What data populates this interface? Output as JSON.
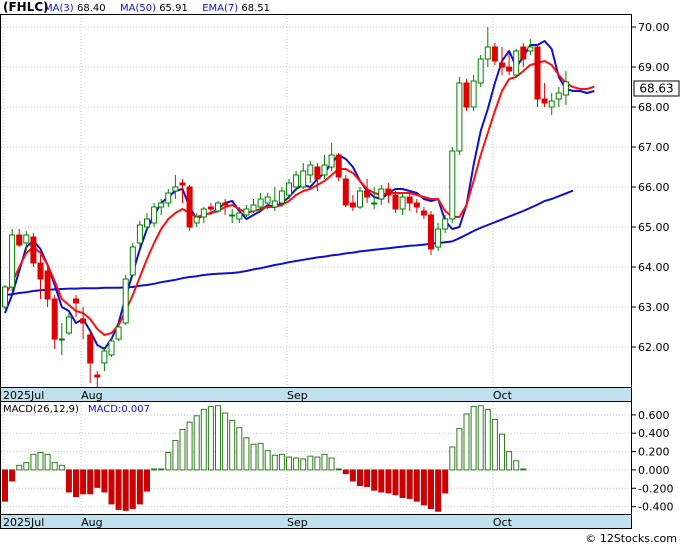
{
  "header": {
    "symbol": "(FHLC)",
    "ma_legend": [
      {
        "label": "MA(3)",
        "value": "68.40"
      },
      {
        "label": "MA(50)",
        "value": "65.91"
      },
      {
        "label": "EMA(7)",
        "value": "68.51"
      }
    ],
    "last_price": "68.63"
  },
  "watermark": "© 12Stocks.com",
  "colors": {
    "up": "#008000",
    "down": "#e00000",
    "ma3": "#1010cc",
    "ma50": "#1010cc",
    "ema7": "#ff1010",
    "macd_pos": "#2e7d1e",
    "macd_neg": "#cc0000",
    "axis_band": "#bfe0ec",
    "frame": "#000000",
    "grid": "#c8c8c8"
  },
  "chart_data": [
    {
      "type": "candlestick",
      "title": "(FHLC)",
      "ylim": [
        61.0,
        70.3
      ],
      "y_ticks": [
        "70.00",
        "69.00",
        "68.00",
        "67.00",
        "66.00",
        "65.00",
        "64.00",
        "63.00",
        "62.00"
      ],
      "x_labels": [
        "2025Jul",
        "Aug",
        "Sep",
        "Oct"
      ],
      "label_at_index": [
        0,
        11,
        40,
        69
      ],
      "grid": true,
      "series": [
        {
          "name": "MA(3)",
          "values": [
            62.85,
            63.3,
            63.9,
            64.5,
            64.65,
            64.45,
            64.05,
            63.55,
            63.0,
            62.9,
            62.6,
            62.7,
            62.4,
            62.05,
            61.95,
            62.2,
            62.6,
            63.25,
            63.85,
            64.45,
            64.95,
            65.3,
            65.6,
            65.75,
            65.9,
            65.95,
            65.5,
            65.2,
            65.3,
            65.35,
            65.45,
            65.6,
            65.65,
            65.4,
            65.2,
            65.3,
            65.4,
            65.55,
            65.5,
            65.6,
            65.75,
            65.95,
            66.05,
            66.0,
            66.2,
            66.35,
            66.6,
            66.8,
            66.7,
            66.5,
            66.15,
            65.9,
            65.75,
            65.7,
            65.85,
            65.95,
            65.95,
            65.9,
            65.85,
            65.7,
            65.65,
            65.7,
            65.15,
            64.95,
            65.0,
            65.55,
            66.55,
            67.4,
            67.95,
            68.6,
            69.15,
            69.4,
            69.0,
            69.25,
            69.55,
            69.55,
            69.65,
            69.45,
            68.75,
            68.45,
            68.4,
            68.4,
            68.35,
            68.4
          ],
          "from_index": 0
        },
        {
          "name": "MA(50)",
          "values": [
            63.3,
            63.32,
            63.35,
            63.37,
            63.4,
            63.42,
            63.43,
            63.44,
            63.45,
            63.46,
            63.46,
            63.47,
            63.47,
            63.47,
            63.48,
            63.48,
            63.48,
            63.49,
            63.5,
            63.53,
            63.55,
            63.58,
            63.62,
            63.65,
            63.68,
            63.72,
            63.75,
            63.77,
            63.8,
            63.82,
            63.83,
            63.84,
            63.85,
            63.87,
            63.9,
            63.94,
            63.97,
            64.01,
            64.05,
            64.08,
            64.12,
            64.15,
            64.18,
            64.21,
            64.24,
            64.26,
            64.29,
            64.31,
            64.34,
            64.36,
            64.39,
            64.41,
            64.43,
            64.45,
            64.47,
            64.49,
            64.51,
            64.53,
            64.54,
            64.56,
            64.58,
            64.6,
            64.62,
            64.64,
            64.72,
            64.81,
            64.9,
            64.98,
            65.05,
            65.12,
            65.19,
            65.26,
            65.33,
            65.4,
            65.48,
            65.56,
            65.65,
            65.7,
            65.77,
            65.84,
            65.91
          ],
          "from_index": 0
        },
        {
          "name": "EMA(7)",
          "values": [
            63.3,
            63.6,
            64.0,
            64.35,
            64.5,
            64.35,
            64.05,
            63.65,
            63.2,
            63.05,
            62.9,
            62.85,
            62.7,
            62.45,
            62.3,
            62.35,
            62.55,
            62.9,
            63.3,
            63.75,
            64.2,
            64.6,
            64.95,
            65.2,
            65.35,
            65.45,
            65.35,
            65.25,
            65.3,
            65.35,
            65.4,
            65.5,
            65.55,
            65.45,
            65.35,
            65.4,
            65.45,
            65.5,
            65.5,
            65.55,
            65.65,
            65.8,
            65.9,
            65.95,
            66.05,
            66.15,
            66.3,
            66.45,
            66.45,
            66.35,
            66.15,
            65.95,
            65.85,
            65.8,
            65.85,
            65.85,
            65.85,
            65.85,
            65.8,
            65.75,
            65.7,
            65.7,
            65.4,
            65.25,
            65.25,
            65.55,
            66.15,
            66.8,
            67.35,
            67.9,
            68.4,
            68.7,
            68.75,
            68.9,
            69.05,
            69.1,
            69.15,
            69.05,
            68.8,
            68.6,
            68.5,
            68.45,
            68.45,
            68.51
          ],
          "from_index": 0
        }
      ],
      "candles": [
        [
          63.0,
          63.5,
          62.95,
          63.55
        ],
        [
          63.5,
          64.8,
          63.4,
          64.95
        ],
        [
          64.8,
          64.55,
          64.5,
          64.95
        ],
        [
          64.6,
          64.8,
          64.4,
          64.9
        ],
        [
          64.75,
          64.1,
          64.0,
          64.85
        ],
        [
          64.1,
          63.7,
          63.2,
          64.3
        ],
        [
          63.9,
          63.2,
          63.0,
          64.0
        ],
        [
          63.2,
          62.2,
          61.95,
          63.3
        ],
        [
          62.2,
          62.2,
          61.8,
          62.6
        ],
        [
          62.35,
          62.75,
          62.3,
          62.85
        ],
        [
          63.2,
          63.1,
          62.75,
          63.3
        ],
        [
          62.7,
          62.6,
          62.2,
          63.0
        ],
        [
          62.3,
          61.6,
          61.1,
          62.4
        ],
        [
          61.3,
          61.25,
          61.0,
          61.4
        ],
        [
          61.6,
          61.9,
          61.4,
          62.0
        ],
        [
          61.8,
          62.15,
          61.75,
          62.25
        ],
        [
          62.2,
          62.5,
          62.15,
          62.55
        ],
        [
          62.6,
          63.7,
          62.55,
          63.8
        ],
        [
          63.8,
          64.5,
          63.75,
          64.6
        ],
        [
          64.6,
          65.05,
          64.5,
          65.15
        ],
        [
          65.0,
          65.2,
          64.9,
          65.35
        ],
        [
          65.1,
          65.5,
          65.0,
          65.6
        ],
        [
          65.5,
          65.6,
          65.3,
          65.7
        ],
        [
          65.6,
          65.85,
          65.5,
          65.95
        ],
        [
          65.9,
          66.0,
          65.7,
          66.3
        ],
        [
          66.1,
          66.05,
          65.6,
          66.2
        ],
        [
          66.0,
          65.0,
          64.9,
          66.05
        ],
        [
          65.1,
          65.25,
          65.0,
          65.35
        ],
        [
          65.25,
          65.45,
          65.1,
          65.5
        ],
        [
          65.5,
          65.45,
          65.3,
          65.6
        ],
        [
          65.4,
          65.6,
          65.35,
          65.65
        ],
        [
          65.6,
          65.55,
          65.3,
          65.7
        ],
        [
          65.3,
          65.3,
          65.1,
          65.45
        ],
        [
          65.2,
          65.35,
          65.1,
          65.5
        ],
        [
          65.3,
          65.45,
          65.25,
          65.55
        ],
        [
          65.4,
          65.55,
          65.35,
          65.7
        ],
        [
          65.5,
          65.7,
          65.4,
          65.85
        ],
        [
          65.6,
          65.75,
          65.45,
          65.85
        ],
        [
          65.5,
          65.65,
          65.4,
          66.0
        ],
        [
          65.6,
          65.9,
          65.5,
          66.0
        ],
        [
          65.8,
          66.1,
          65.7,
          66.2
        ],
        [
          66.0,
          66.3,
          65.9,
          66.4
        ],
        [
          66.0,
          66.4,
          65.95,
          66.6
        ],
        [
          66.3,
          66.55,
          66.1,
          66.65
        ],
        [
          66.5,
          66.2,
          65.9,
          66.6
        ],
        [
          66.3,
          66.55,
          66.2,
          66.8
        ],
        [
          66.5,
          66.8,
          66.4,
          67.1
        ],
        [
          66.8,
          66.25,
          66.15,
          66.85
        ],
        [
          66.2,
          65.55,
          65.5,
          66.3
        ],
        [
          65.6,
          65.5,
          65.4,
          65.8
        ],
        [
          65.5,
          65.9,
          65.45,
          66.0
        ],
        [
          65.9,
          65.75,
          65.6,
          66.2
        ],
        [
          65.6,
          65.6,
          65.45,
          66.0
        ],
        [
          65.7,
          65.95,
          65.55,
          66.05
        ],
        [
          65.95,
          65.8,
          65.6,
          66.1
        ],
        [
          65.8,
          65.45,
          65.35,
          65.9
        ],
        [
          65.45,
          65.75,
          65.3,
          65.85
        ],
        [
          65.75,
          65.6,
          65.4,
          65.9
        ],
        [
          65.6,
          65.5,
          65.35,
          65.7
        ],
        [
          65.4,
          65.3,
          65.2,
          65.5
        ],
        [
          65.3,
          64.45,
          64.3,
          65.4
        ],
        [
          64.5,
          64.95,
          64.4,
          65.1
        ],
        [
          64.95,
          65.2,
          64.85,
          65.3
        ],
        [
          65.2,
          66.9,
          65.1,
          67.0
        ],
        [
          66.9,
          68.6,
          66.8,
          68.75
        ],
        [
          68.6,
          68.0,
          67.9,
          68.7
        ],
        [
          68.0,
          68.65,
          67.9,
          68.8
        ],
        [
          68.6,
          69.2,
          68.5,
          69.3
        ],
        [
          69.2,
          69.5,
          69.0,
          70.0
        ],
        [
          69.5,
          69.15,
          69.05,
          69.6
        ],
        [
          69.1,
          69.0,
          68.8,
          69.5
        ],
        [
          69.0,
          68.9,
          68.8,
          69.35
        ],
        [
          68.8,
          69.4,
          68.75,
          69.45
        ],
        [
          69.5,
          69.2,
          69.0,
          69.6
        ],
        [
          69.4,
          69.5,
          69.3,
          69.7
        ],
        [
          69.5,
          68.2,
          68.0,
          69.55
        ],
        [
          68.2,
          68.1,
          68.0,
          68.6
        ],
        [
          68.0,
          68.15,
          67.8,
          68.35
        ],
        [
          68.2,
          68.35,
          68.0,
          68.5
        ],
        [
          68.3,
          68.63,
          68.05,
          68.9
        ]
      ]
    },
    {
      "type": "bar",
      "title": "MACD(26,12,9)",
      "value_label": "MACD:0.007",
      "ylim": [
        -0.48,
        0.74
      ],
      "y_ticks": [
        "0.600",
        "0.400",
        "0.200",
        "0.000",
        "-0.200",
        "-0.400"
      ],
      "x_labels": [
        "2025Jul",
        "Aug",
        "Sep",
        "Oct"
      ],
      "label_at_index": [
        0,
        11,
        40,
        69
      ],
      "values": [
        -0.34,
        -0.12,
        0.05,
        0.08,
        0.17,
        0.19,
        0.17,
        0.08,
        0.05,
        -0.24,
        -0.29,
        -0.26,
        -0.26,
        -0.19,
        -0.24,
        -0.37,
        -0.43,
        -0.44,
        -0.42,
        -0.37,
        -0.23,
        0.0,
        0.0,
        0.19,
        0.32,
        0.44,
        0.52,
        0.59,
        0.66,
        0.69,
        0.7,
        0.62,
        0.54,
        0.46,
        0.35,
        0.28,
        0.29,
        0.21,
        0.16,
        0.17,
        0.14,
        0.13,
        0.12,
        0.15,
        0.14,
        0.17,
        0.13,
        0.0,
        -0.04,
        -0.12,
        -0.17,
        -0.18,
        -0.22,
        -0.24,
        -0.25,
        -0.27,
        -0.3,
        -0.31,
        -0.34,
        -0.38,
        -0.42,
        -0.45,
        -0.25,
        0.25,
        0.45,
        0.61,
        0.69,
        0.7,
        0.66,
        0.55,
        0.39,
        0.2,
        0.1,
        0.007
      ]
    }
  ]
}
